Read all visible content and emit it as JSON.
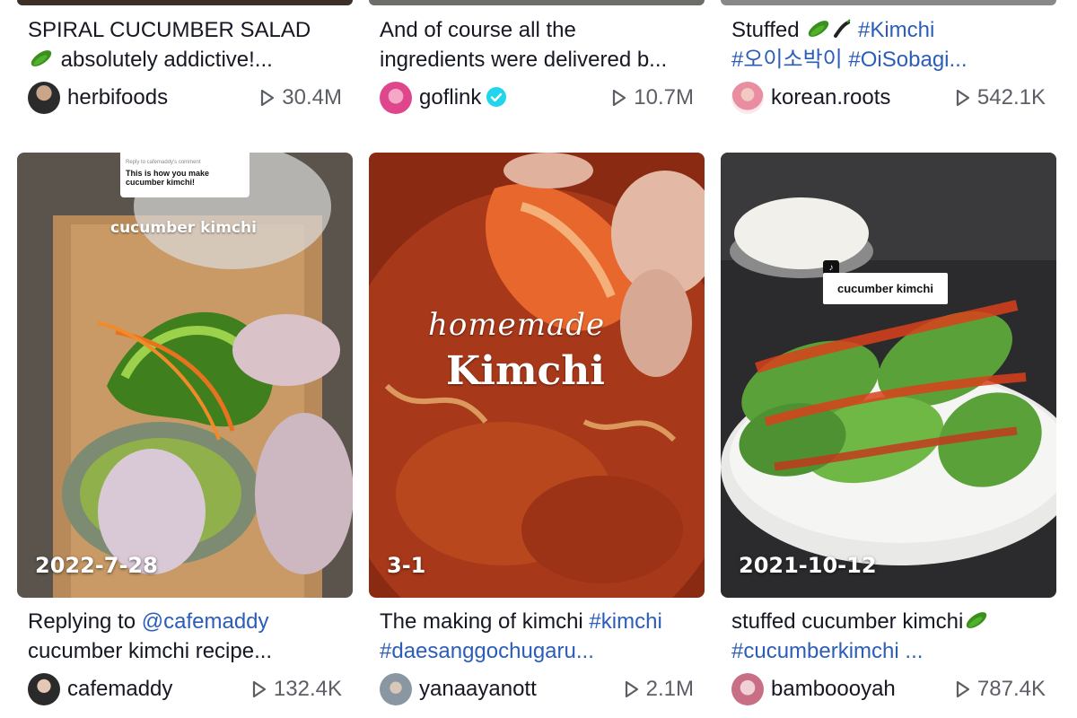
{
  "cards": [
    {
      "caption_line1": "SPIRAL CUCUMBER SALAD",
      "caption_line2": "absolutely addictive!...",
      "author": "herbifoods",
      "views": "30.4M"
    },
    {
      "caption_line1": "And of course all the",
      "caption_line2": "ingredients were delivered b...",
      "author": "goflink",
      "verified": true,
      "views": "10.7M"
    },
    {
      "caption_line1_text": "Stuffed",
      "caption_line1_tag": "#Kimchi",
      "caption_line2": "#오이소박이 #OiSobagi...",
      "author": "korean.roots",
      "views": "542.1K"
    },
    {
      "comment_header": "Reply to cafemaddy's comment",
      "comment_text": "This is how you make cucumber kimchi!",
      "overlay_title": "cucumber kimchi",
      "date": "2022-7-28",
      "caption_line1_text": "Replying to",
      "caption_line1_tag": "@cafemaddy",
      "caption_line2": "cucumber kimchi recipe...",
      "author": "cafemaddy",
      "views": "132.4K"
    },
    {
      "overlay_script": "homemade",
      "overlay_title": "Kimchi",
      "date": "3-1",
      "caption_line1_text": "The making of kimchi",
      "caption_line1_tag": "#kimchi",
      "caption_line2": "#daesanggochugaru...",
      "author": "yanaayanott",
      "views": "2.1M"
    },
    {
      "overlay_tag": "cucumber kimchi",
      "date": "2021-10-12",
      "caption_line1_text": "stuffed cucumber kimchi",
      "caption_line2": "#cucumberkimchi ...",
      "author": "bamboooyah",
      "views": "787.4K"
    }
  ],
  "colors": {
    "hashtag": "#2b5db9",
    "text": "#161823",
    "views": "#5c5e66",
    "verified": "#20d5ec"
  }
}
